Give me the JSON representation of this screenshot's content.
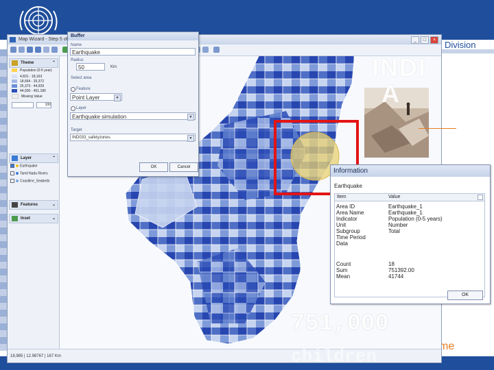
{
  "slide": {
    "division_text": "Division",
    "programme_text": "me",
    "overlay_title": "INDI",
    "overlay_title_2": "A",
    "overlay_number": "751,000",
    "overlay_word": "children"
  },
  "window": {
    "title": "Map Wizard - Step 5 of 5",
    "buttons": [
      "_",
      "□",
      "×"
    ]
  },
  "side_panel": {
    "theme_header": "Theme",
    "theme_indicator": "Population (0-5 year)",
    "legend": [
      {
        "label": "4,831 - 18,163",
        "color": "#d6e0f5"
      },
      {
        "label": "18,664 - 25,372",
        "color": "#a3b8e6"
      },
      {
        "label": "25,373 - 44,929",
        "color": "#6b8ed6"
      },
      {
        "label": "44,930 - 451,180",
        "color": "#2c4fb8"
      },
      {
        "label": "Missing Value",
        "color": "#eeeeee"
      }
    ],
    "legend_input": "100",
    "layer_header": "Layer",
    "layers": [
      {
        "label": "Earthquake",
        "dot_color": "#e8c21b",
        "checked": true
      },
      {
        "label": "Tamil Nadu Rivers",
        "dot_color": "#3a7bd5",
        "checked": false
      },
      {
        "label": "Coastline_Seabeds",
        "dot_color": "#7aa7e0",
        "checked": false
      }
    ],
    "features_header": "Features",
    "inset_header": "Inset"
  },
  "status": {
    "text": "18,985 | 12.98767 | 167 Km"
  },
  "buffer_dialog": {
    "title": "Buffer",
    "name_label": "Name",
    "name_value": "Earthquake",
    "radius_label": "Radius",
    "radius_value": "50",
    "radius_unit": "Km",
    "select_label": "Select area",
    "feature_option": "Feature",
    "point_layer": "Point Layer",
    "layer_option": "Layer",
    "layer_value": "Earthquake simulation",
    "target_label": "Target",
    "target_value": "IND033_safetyzones",
    "ok": "OK",
    "cancel": "Cancel"
  },
  "information": {
    "title": "Information",
    "subject": "Earthquake",
    "col_item": "Item",
    "col_value": "Value",
    "rows": [
      {
        "k": "Area ID",
        "v": "Earthquake_1"
      },
      {
        "k": "Area Name",
        "v": "Earthquake_1"
      },
      {
        "k": "Indicator",
        "v": "Population (0-5 years)"
      },
      {
        "k": "Unit",
        "v": "Number"
      },
      {
        "k": "Subgroup",
        "v": "Total"
      },
      {
        "k": "Time Period",
        "v": ""
      },
      {
        "k": "Data",
        "v": ""
      },
      {
        "k": "",
        "v": ""
      },
      {
        "k": "Count",
        "v": "18"
      },
      {
        "k": "Sum",
        "v": "751392.00"
      },
      {
        "k": "Mean",
        "v": "41744"
      }
    ],
    "ok": "OK"
  },
  "colors": {
    "slide_blue": "#1f4e9c",
    "highlight_box": "#e31414",
    "buffer_circle": "#e8d070",
    "accent_orange": "#e67e22"
  }
}
